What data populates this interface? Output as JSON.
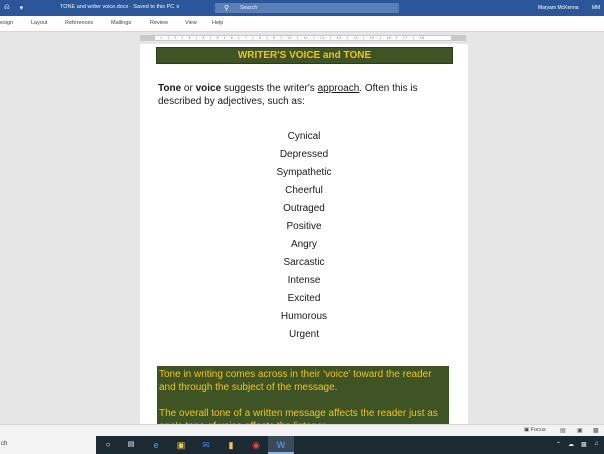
{
  "titlebar": {
    "quick_access": [
      "⎌",
      "▾"
    ],
    "document_title": "TONE and writer voice.docx  ·  Saved to this PC ∨",
    "search_placeholder": "Search",
    "user_name": "Maryam McKenna",
    "user_initials": "MM"
  },
  "ribbon": {
    "tabs": [
      "esign",
      "Layout",
      "References",
      "Mailings",
      "Review",
      "View",
      "Help"
    ]
  },
  "ruler": {
    "marks": "· 1 · 1 · 2 · 1 · 3 · 1 · 4 · 1 · 5 · 1 · 6 · 1 · 7 · 1 · 8 · 1 · 9 · 1 · 10 · 1 · 11 · 1 · 12 · 1 · 13 · 1 · 14 · 1 · 15 · 1 · 16 · 1 · 17 · 1 · 18"
  },
  "document": {
    "heading": "WRITER'S VOICE and TONE",
    "intro": {
      "bold1": "Tone",
      "text1": " or ",
      "bold2": "voice",
      "text2": " suggests the writer's ",
      "underlined": "approach",
      "text3": ". Often this is described by adjectives, such as:"
    },
    "tones": [
      "Cynical",
      "Depressed",
      "Sympathetic",
      "Cheerful",
      "Outraged",
      "Positive",
      "Angry",
      "Sarcastic",
      "Intense",
      "Excited",
      "Humorous",
      "Urgent"
    ],
    "box_paragraph_1": "Tone in writing comes across in their ‘voice’ toward the reader and through the subject of the message.",
    "box_paragraph_2": "The overall tone of a written message affects the reader just as one's tone of voice affects the listener."
  },
  "statusbar": {
    "focus_label": "Focus"
  },
  "taskbar": {
    "search_text": "ch"
  },
  "colors": {
    "title_blue": "#2b579a",
    "box_green": "#3f5424",
    "box_text_yellow": "#f0c31a",
    "taskbar": "#1c2a33"
  }
}
